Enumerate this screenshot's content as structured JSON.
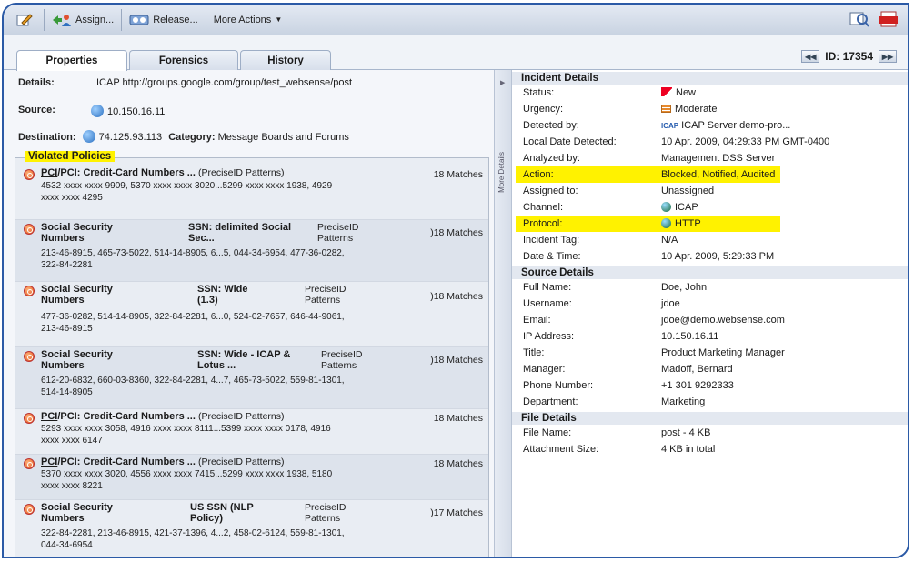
{
  "toolbar": {
    "assign_label": "Assign...",
    "release_label": "Release...",
    "more_actions_label": "More Actions"
  },
  "tabs": [
    {
      "label": "Properties",
      "active": true
    },
    {
      "label": "Forensics",
      "active": false
    },
    {
      "label": "History",
      "active": false
    }
  ],
  "incident_id": "ID: 17354",
  "details": {
    "details_label": "Details:",
    "details_value": "ICAP http://groups.google.com/group/test_websense/post",
    "source_label": "Source:",
    "source_value": "10.150.16.11",
    "destination_label": "Destination:",
    "destination_value": "74.125.93.113",
    "category_label": "Category:",
    "category_value": "Message Boards and Forums"
  },
  "violated_policies": {
    "title": "Violated Policies",
    "items": [
      {
        "name_u": "PCI",
        "name_rest": "/PCI: Credit-Card Numbers ...",
        "pattern": "(PreciseID Patterns)",
        "matches": "18 Matches",
        "values": [
          "4532 xxxx xxxx 9909, 5370 xxxx xxxx 3020...5299 xxxx xxxx 1938, 4929",
          "xxxx xxxx 4295"
        ]
      },
      {
        "name_a": "Social Security",
        "name_b": "Numbers",
        "sub_a": "SSN: delimited Social",
        "sub_b": "Sec...",
        "pat_a": "PreciseID",
        "pat_b": "Patterns",
        "matches": ")18 Matches",
        "values": [
          "213-46-8915, 465-73-5022, 514-14-8905, 6...5, 044-34-6954, 477-36-0282,",
          "322-84-2281"
        ]
      },
      {
        "name_a": "Social Security",
        "name_b": "Numbers",
        "sub_a": "SSN: Wide",
        "sub_b": "(1.3)",
        "pat_a": "PreciseID",
        "pat_b": "Patterns",
        "matches": ")18 Matches",
        "values": [
          "477-36-0282, 514-14-8905, 322-84-2281, 6...0, 524-02-7657, 646-44-9061,",
          "213-46-8915"
        ]
      },
      {
        "name_a": "Social Security",
        "name_b": "Numbers",
        "sub_a": "SSN: Wide - ICAP &",
        "sub_b": "Lotus ...",
        "pat_a": "PreciseID",
        "pat_b": "Patterns",
        "matches": ")18 Matches",
        "values": [
          "612-20-6832, 660-03-8360, 322-84-2281, 4...7, 465-73-5022, 559-81-1301,",
          "514-14-8905"
        ]
      },
      {
        "name_u": "PCI",
        "name_rest": "/PCI: Credit-Card Numbers ...",
        "pattern": "(PreciseID Patterns)",
        "matches": "18 Matches",
        "values": [
          "5293 xxxx xxxx 3058, 4916 xxxx xxxx 8111...5399 xxxx xxxx 0178, 4916",
          "xxxx xxxx 6147"
        ]
      },
      {
        "name_u": "PCI",
        "name_rest": "/PCI: Credit-Card Numbers ...",
        "pattern": "(PreciseID Patterns)",
        "matches": "18 Matches",
        "values": [
          "5370 xxxx xxxx 3020, 4556 xxxx xxxx 7415...5299 xxxx xxxx 1938, 5180",
          "xxxx xxxx 8221"
        ]
      },
      {
        "name_a": "Social Security",
        "name_b": "Numbers",
        "sub_a": "US SSN (NLP",
        "sub_b": "Policy)",
        "pat_a": "PreciseID",
        "pat_b": "Patterns",
        "matches": ")17 Matches",
        "values": [
          "322-84-2281, 213-46-8915, 421-37-1396, 4...2, 458-02-6124, 559-81-1301,",
          "044-34-6954"
        ]
      }
    ]
  },
  "splitter_label": "More Details",
  "incident_details": {
    "title": "Incident Details",
    "rows": [
      {
        "k": "Status:",
        "v": "New"
      },
      {
        "k": "Urgency:",
        "v": "Moderate"
      },
      {
        "k": "Detected by:",
        "v": "ICAP Server demo-pro..."
      },
      {
        "k": "Local Date Detected:",
        "v": "10 Apr. 2009, 04:29:33 PM GMT-0400"
      },
      {
        "k": "Analyzed by:",
        "v": "Management DSS Server"
      },
      {
        "k": "Action:",
        "v": "Blocked, Notified, Audited"
      },
      {
        "k": "Assigned to:",
        "v": "Unassigned"
      },
      {
        "k": "Channel:",
        "v": "ICAP"
      },
      {
        "k": "Protocol:",
        "v": "HTTP"
      },
      {
        "k": "Incident Tag:",
        "v": "N/A"
      },
      {
        "k": "Date & Time:",
        "v": "10 Apr. 2009, 5:29:33 PM"
      }
    ],
    "detector_abbr": "ICAP"
  },
  "source_details": {
    "title": "Source Details",
    "rows": [
      {
        "k": "Full Name:",
        "v": "Doe, John"
      },
      {
        "k": "Username:",
        "v": "jdoe"
      },
      {
        "k": "Email:",
        "v": "jdoe@demo.websense.com"
      },
      {
        "k": "IP Address:",
        "v": "10.150.16.11"
      },
      {
        "k": "Title:",
        "v": "Product Marketing Manager"
      },
      {
        "k": "Manager:",
        "v": "Madoff, Bernard"
      },
      {
        "k": "Phone Number:",
        "v": "+1 301 9292333"
      },
      {
        "k": "Department:",
        "v": "Marketing"
      }
    ]
  },
  "file_details": {
    "title": "File Details",
    "rows": [
      {
        "k": "File Name:",
        "v": "post - 4 KB"
      },
      {
        "k": "Attachment Size:",
        "v": "4 KB in total"
      }
    ]
  },
  "colors": {
    "highlight": "#fff200",
    "frame": "#2b5aa6"
  }
}
